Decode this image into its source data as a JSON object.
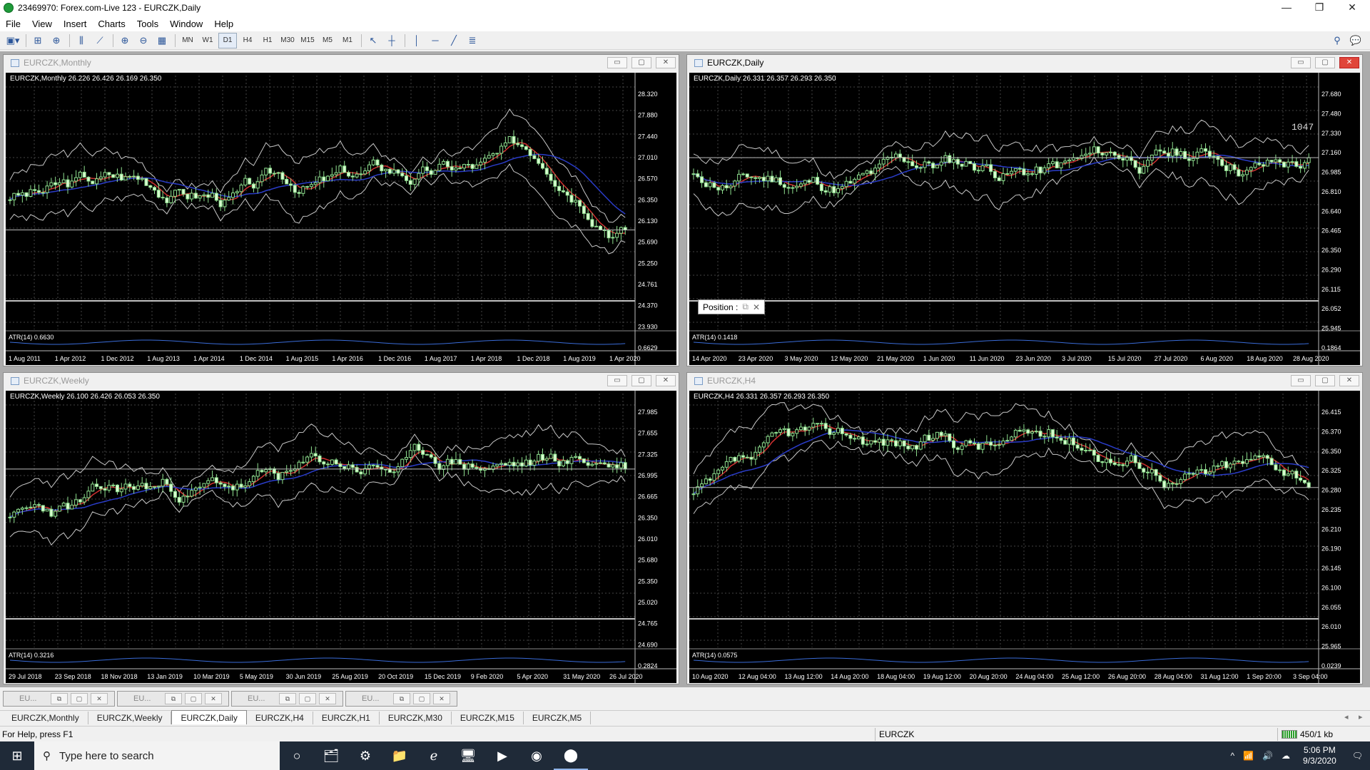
{
  "window": {
    "title": "23469970: Forex.com-Live 123 - EURCZK,Daily",
    "minimize": "—",
    "restore": "❐",
    "close": "✕"
  },
  "menu": [
    "File",
    "View",
    "Insert",
    "Charts",
    "Tools",
    "Window",
    "Help"
  ],
  "toolbar": {
    "timeframes": [
      "MN",
      "W1",
      "D1",
      "H4",
      "H1",
      "M30",
      "M15",
      "M5",
      "M1"
    ],
    "active_timeframe": "D1"
  },
  "charts": {
    "monthly": {
      "title": "EURCZK,Monthly",
      "header": "EURCZK,Monthly  26.226 26.426 26.169 26.350",
      "atr": "ATR(14) 0.6630",
      "price_labels": [
        "28.320",
        "27.880",
        "27.440",
        "27.010",
        "26.570",
        "26.350",
        "26.130",
        "25.690",
        "25.250",
        "24.761",
        "24.370",
        "23.930",
        "0.6629"
      ],
      "date_labels": [
        "1 Aug 2011",
        "1 Apr 2012",
        "1 Dec 2012",
        "1 Aug 2013",
        "1 Apr 2014",
        "1 Dec 2014",
        "1 Aug 2015",
        "1 Apr 2016",
        "1 Dec 2016",
        "1 Aug 2017",
        "1 Apr 2018",
        "1 Dec 2018",
        "1 Aug 2019",
        "1 Apr 2020"
      ]
    },
    "daily": {
      "title": "EURCZK,Daily",
      "header": "EURCZK,Daily  26.331 26.357 26.293 26.350",
      "atr": "ATR(14) 0.1418",
      "price_labels": [
        "27.680",
        "27.480",
        "27.330",
        "27.160",
        "26.985",
        "26.810",
        "26.640",
        "26.465",
        "26.350",
        "26.290",
        "26.115",
        "26.052",
        "25.945",
        "0.1864"
      ],
      "date_labels": [
        "14 Apr 2020",
        "23 Apr 2020",
        "3 May 2020",
        "12 May 2020",
        "21 May 2020",
        "1 Jun 2020",
        "11 Jun 2020",
        "23 Jun 2020",
        "3 Jul 2020",
        "15 Jul 2020",
        "27 Jul 2020",
        "6 Aug 2020",
        "18 Aug 2020",
        "28 Aug 2020"
      ],
      "annotation": "1047",
      "popup": "Position :"
    },
    "weekly": {
      "title": "EURCZK,Weekly",
      "header": "EURCZK,Weekly  26.100 26.426 26.053 26.350",
      "atr": "ATR(14) 0.3216",
      "price_labels": [
        "27.985",
        "27.655",
        "27.325",
        "26.995",
        "26.665",
        "26.350",
        "26.010",
        "25.680",
        "25.350",
        "25.020",
        "24.765",
        "24.690",
        "0.2824"
      ],
      "date_labels": [
        "29 Jul 2018",
        "23 Sep 2018",
        "18 Nov 2018",
        "13 Jan 2019",
        "10 Mar 2019",
        "5 May 2019",
        "30 Jun 2019",
        "25 Aug 2019",
        "20 Oct 2019",
        "15 Dec 2019",
        "9 Feb 2020",
        "5 Apr 2020",
        "31 May 2020",
        "26 Jul 2020"
      ]
    },
    "h4": {
      "title": "EURCZK,H4",
      "header": "EURCZK,H4  26.331 26.357 26.293 26.350",
      "atr": "ATR(14) 0.0575",
      "price_labels": [
        "26.415",
        "26.370",
        "26.350",
        "26.325",
        "26.280",
        "26.235",
        "26.210",
        "26.190",
        "26.145",
        "26.100",
        "26.055",
        "26.010",
        "25.965",
        "0.0239"
      ],
      "date_labels": [
        "10 Aug 2020",
        "12 Aug 04:00",
        "13 Aug 12:00",
        "14 Aug 20:00",
        "18 Aug 04:00",
        "19 Aug 12:00",
        "20 Aug 20:00",
        "24 Aug 04:00",
        "25 Aug 12:00",
        "26 Aug 20:00",
        "28 Aug 04:00",
        "31 Aug 12:00",
        "1 Sep 20:00",
        "3 Sep 04:00"
      ]
    }
  },
  "minimized": [
    "EU...",
    "EU...",
    "EU...",
    "EU..."
  ],
  "tabs": [
    "EURCZK,Monthly",
    "EURCZK,Weekly",
    "EURCZK,Daily",
    "EURCZK,H4",
    "EURCZK,H1",
    "EURCZK,M30",
    "EURCZK,M15",
    "EURCZK,M5"
  ],
  "active_tab": "EURCZK,Daily",
  "status": {
    "help": "For Help, press F1",
    "symbol": "EURCZK",
    "network": "450/1 kb"
  },
  "taskbar": {
    "search_placeholder": "Type here to search",
    "time": "5:06 PM",
    "date": "9/3/2020"
  }
}
